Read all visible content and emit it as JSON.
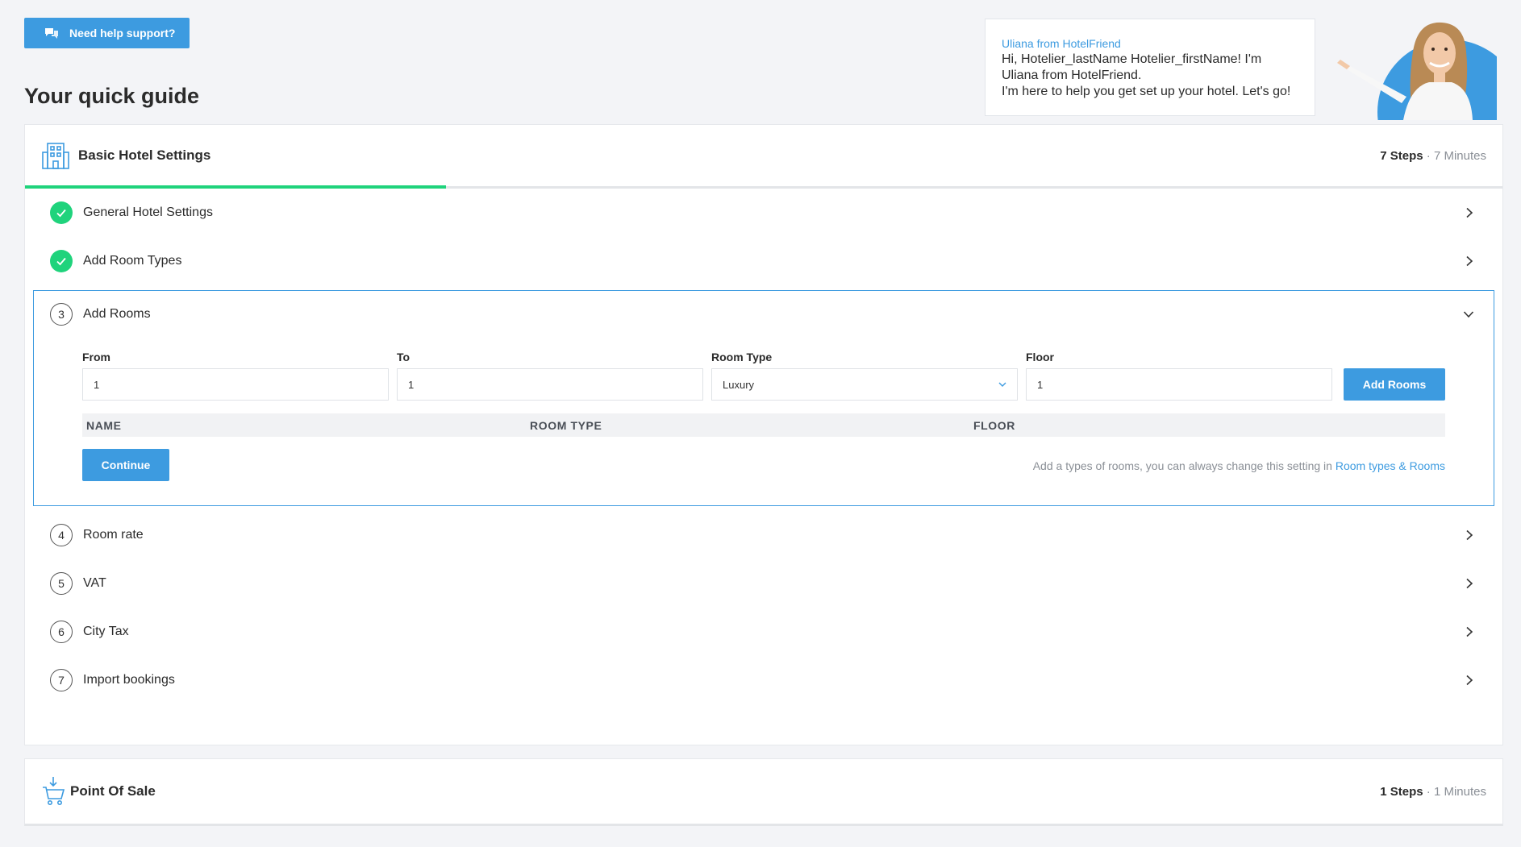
{
  "help": {
    "label": "Need help support?"
  },
  "page": {
    "title": "Your quick guide"
  },
  "assistant": {
    "from": "Uliana from HotelFriend",
    "line1": "Hi, Hotelier_lastName Hotelier_firstName! I'm Uliana from HotelFriend.",
    "line2": "I'm here to help you get set up your hotel. Let's go!"
  },
  "colors": {
    "accent": "#3d9be0",
    "success": "#1fd37c"
  },
  "basic_settings": {
    "title": "Basic Hotel Settings",
    "steps_count": "7 Steps",
    "separator": " · ",
    "duration": "7 Minutes",
    "progress_fraction": 0.285,
    "steps": [
      {
        "num": "1",
        "label": "General Hotel Settings",
        "done": true
      },
      {
        "num": "2",
        "label": "Add Room Types",
        "done": true
      },
      {
        "num": "3",
        "label": "Add Rooms",
        "done": false
      },
      {
        "num": "4",
        "label": "Room rate",
        "done": false
      },
      {
        "num": "5",
        "label": "VAT",
        "done": false
      },
      {
        "num": "6",
        "label": "City Tax",
        "done": false
      },
      {
        "num": "7",
        "label": "Import bookings",
        "done": false
      }
    ]
  },
  "add_rooms_form": {
    "from_label": "From",
    "from_value": "1",
    "to_label": "To",
    "to_value": "1",
    "room_type_label": "Room Type",
    "room_type_value": "Luxury",
    "floor_label": "Floor",
    "floor_value": "1",
    "add_button": "Add Rooms",
    "table_headers": [
      "NAME",
      "ROOM TYPE",
      "FLOOR"
    ],
    "continue_button": "Continue",
    "hint_text": "Add a types of rooms, you can always change this setting in",
    "hint_link": "Room types & Rooms"
  },
  "point_of_sale": {
    "title": "Point Of Sale",
    "steps_count": "1 Steps",
    "separator": " · ",
    "duration": "1 Minutes"
  }
}
